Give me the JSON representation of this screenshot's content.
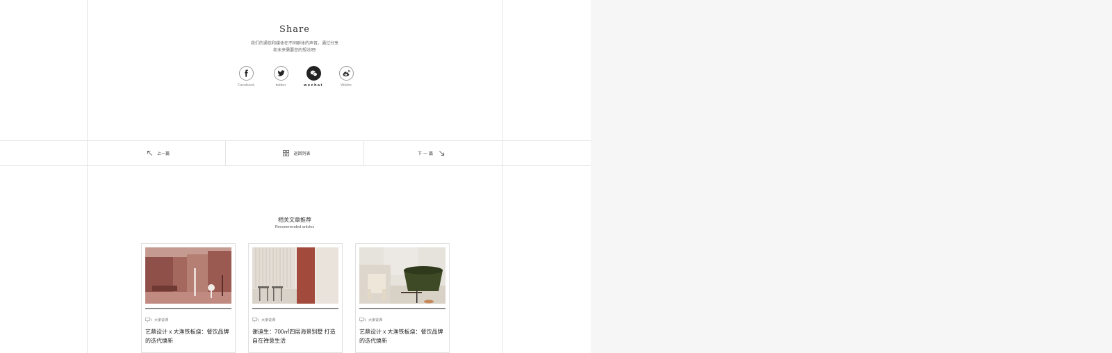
{
  "share": {
    "title": "Share",
    "desc_line1": "我们的通信和媒体在不同群体的声音。通过分享",
    "desc_line2": "和未来需要您的想法吧!",
    "items": [
      {
        "label": "Facebook",
        "icon": "facebook-icon"
      },
      {
        "label": "twitter",
        "icon": "twitter-icon"
      },
      {
        "label": "wechat",
        "icon": "wechat-icon"
      },
      {
        "label": "Weibo",
        "icon": "weibo-icon"
      }
    ]
  },
  "nav": {
    "prev": "上一篇",
    "list": "返回列表",
    "next": "下一篇"
  },
  "recommended": {
    "title": "相关文章推荐",
    "subtitle": "Recommended articles",
    "cards": [
      {
        "category": "大家说课",
        "title": "艺鼎设计 x 大渔铁板烧：餐饮品牌的迭代焕新"
      },
      {
        "category": "大家说课",
        "title": "谢迪生：700㎡四层海景别墅 打造自在禅意生活"
      },
      {
        "category": "大家说课",
        "title": "艺鼎设计 x 大渔铁板烧：餐饮品牌的迭代焕新"
      }
    ]
  },
  "colors": {
    "active_social": "#222222",
    "border": "#e4e4e4",
    "right_panel": "#f6f6f6"
  }
}
